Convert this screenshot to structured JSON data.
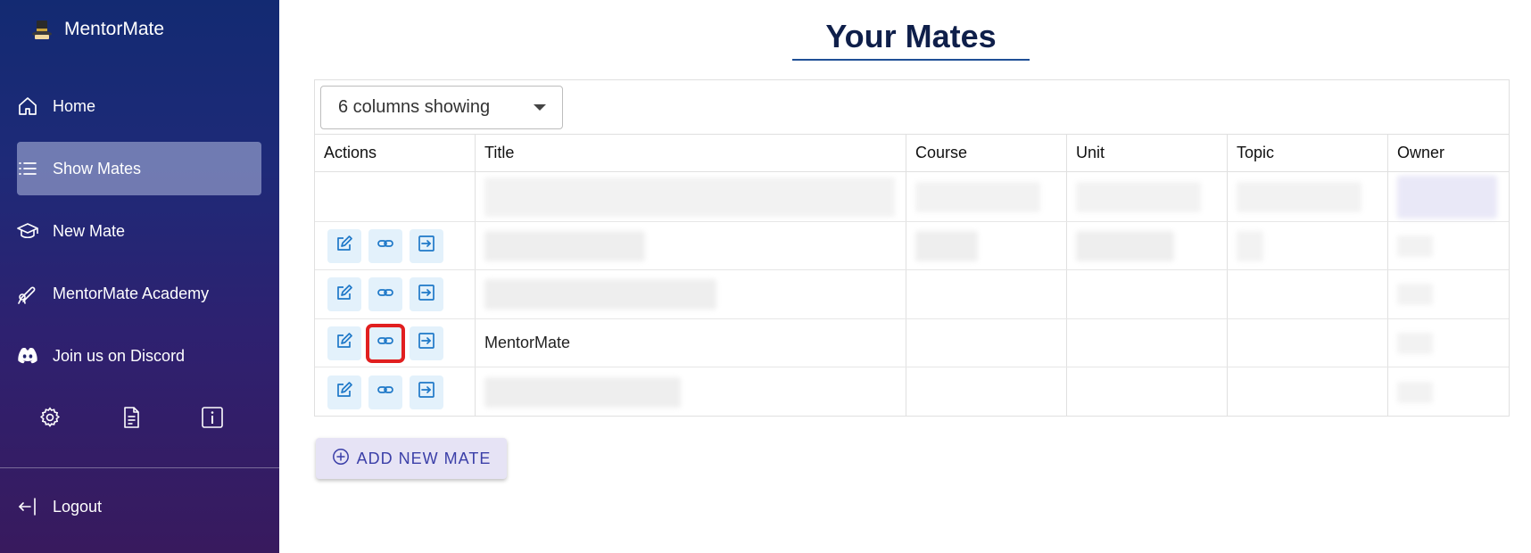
{
  "brand": {
    "name": "MentorMate",
    "logo_icon": "top-hat-icon"
  },
  "sidebar": {
    "items": [
      {
        "label": "Home",
        "icon": "home-icon"
      },
      {
        "label": "Show Mates",
        "icon": "list-icon",
        "active": true
      },
      {
        "label": "New Mate",
        "icon": "graduation-cap-icon"
      },
      {
        "label": "MentorMate Academy",
        "icon": "diploma-icon"
      },
      {
        "label": "Join us on Discord",
        "icon": "discord-icon"
      }
    ],
    "utility_icons": [
      "gear-icon",
      "document-icon",
      "info-icon"
    ],
    "logout_label": "Logout"
  },
  "page": {
    "title": "Your Mates"
  },
  "grid": {
    "columns_select_label": "6 columns showing",
    "columns": [
      "Actions",
      "Title",
      "Course",
      "Unit",
      "Topic",
      "Owner"
    ],
    "rows": [
      {
        "title": "",
        "blurred": true
      },
      {
        "title": "",
        "blurred": true
      },
      {
        "title": "MentorMate",
        "blurred": false,
        "link_highlighted": true
      },
      {
        "title": "",
        "blurred": true
      }
    ]
  },
  "add_button": {
    "label": "ADD NEW MATE",
    "icon": "plus-circle-icon"
  },
  "colors": {
    "sidebar_top": "#132a72",
    "sidebar_bottom": "#381a5e",
    "accent": "#1f4f96",
    "action_bg": "#e3f1fb",
    "action_icon": "#1e78c8",
    "highlight": "#e11f1f",
    "add_button_bg": "#e6e3f5",
    "add_button_text": "#3b3fa8"
  }
}
